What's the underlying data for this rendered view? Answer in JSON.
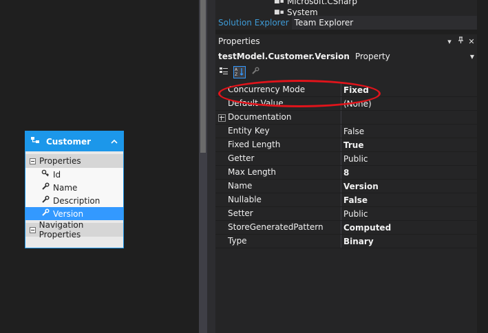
{
  "entity": {
    "name": "Customer",
    "group_properties": "Properties",
    "properties": [
      {
        "label": "Id",
        "icon": "key-icon"
      },
      {
        "label": "Name",
        "icon": "wrench-icon"
      },
      {
        "label": "Description",
        "icon": "wrench-icon"
      },
      {
        "label": "Version",
        "icon": "wrench-icon",
        "selected": true
      }
    ],
    "group_navigation": "Navigation Properties"
  },
  "tree": {
    "items": [
      "Microsoft.CSharp",
      "System"
    ]
  },
  "tabs": [
    {
      "label": "Solution Explorer",
      "active": true
    },
    {
      "label": "Team Explorer",
      "active": false
    }
  ],
  "properties_panel": {
    "title": "Properties",
    "object_name": "testModel.Customer.Version",
    "object_type": "Property",
    "rows": [
      {
        "key": "Concurrency Mode",
        "value": "Fixed",
        "bold": true,
        "expander": false
      },
      {
        "key": "Default Value",
        "value": "(None)",
        "bold": false,
        "expander": false
      },
      {
        "key": "Documentation",
        "value": "",
        "bold": false,
        "expander": true
      },
      {
        "key": "Entity Key",
        "value": "False",
        "bold": false,
        "expander": false
      },
      {
        "key": "Fixed Length",
        "value": "True",
        "bold": true,
        "expander": false
      },
      {
        "key": "Getter",
        "value": "Public",
        "bold": false,
        "expander": false
      },
      {
        "key": "Max Length",
        "value": "8",
        "bold": true,
        "expander": false
      },
      {
        "key": "Name",
        "value": "Version",
        "bold": true,
        "expander": false
      },
      {
        "key": "Nullable",
        "value": "False",
        "bold": true,
        "expander": false
      },
      {
        "key": "Setter",
        "value": "Public",
        "bold": false,
        "expander": false
      },
      {
        "key": "StoreGeneratedPattern",
        "value": "Computed",
        "bold": true,
        "expander": false
      },
      {
        "key": "Type",
        "value": "Binary",
        "bold": true,
        "expander": false
      }
    ]
  },
  "colors": {
    "accent": "#1c97ea",
    "annotation": "#e0141b",
    "background": "#1f1f1f"
  }
}
